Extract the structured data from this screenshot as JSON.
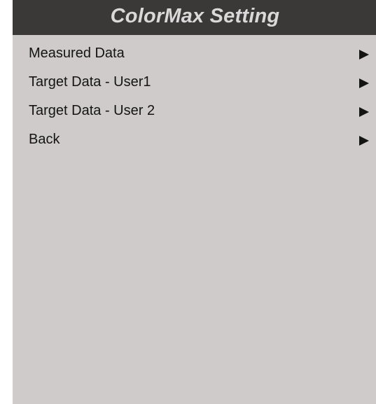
{
  "header": {
    "title": "ColorMax Setting"
  },
  "menu": {
    "items": [
      {
        "label": "Measured Data",
        "icon": "submenu-arrow-icon"
      },
      {
        "label": "Target Data - User1",
        "icon": "submenu-arrow-icon"
      },
      {
        "label": "Target Data - User 2",
        "icon": "submenu-arrow-icon"
      },
      {
        "label": "Back",
        "icon": "submenu-arrow-icon"
      }
    ]
  },
  "colors": {
    "header_background": "#3b3838",
    "header_text": "#d9d9d9",
    "panel_background": "#cfcbca",
    "item_text": "#141414"
  }
}
